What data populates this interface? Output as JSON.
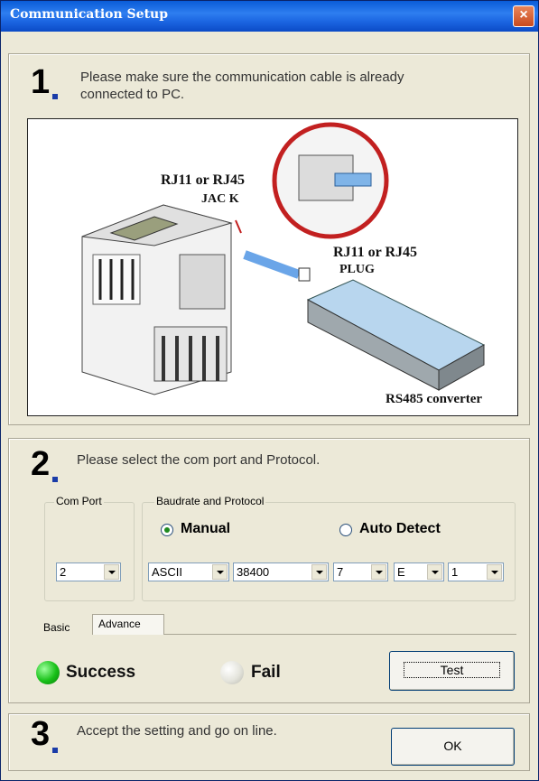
{
  "window": {
    "title": "Communication Setup",
    "close_symbol": "×"
  },
  "step1": {
    "number": "1",
    "text_line1": "Please make sure the communication cable is already",
    "text_line2": "connected to PC.",
    "image": {
      "jack_label_line1": "RJ11 or RJ45",
      "jack_label_line2": "JAC K",
      "plug_label_line1": "RJ11 or RJ45",
      "plug_label_line2": "PLUG",
      "converter_label": "RS485 converter"
    }
  },
  "step2": {
    "number": "2",
    "text": "Please select the com port and Protocol.",
    "com_port": {
      "caption": "Com Port",
      "value": "2"
    },
    "baud": {
      "caption": "Baudrate and Protocol",
      "manual_label": "Manual",
      "auto_label": "Auto Detect",
      "selected": "Manual",
      "protocol": "ASCII",
      "baudrate": "38400",
      "data_bits": "7",
      "parity": "E",
      "stop_bits": "1"
    },
    "tabs": [
      "Basic",
      "Advance"
    ],
    "active_tab": "Basic",
    "status": {
      "success_label": "Success",
      "fail_label": "Fail",
      "current": "Success"
    },
    "test_button": "Test"
  },
  "step3": {
    "number": "3",
    "text": "Accept the setting and go on line.",
    "ok_button": "OK"
  },
  "colors": {
    "title_bar": "#0a5cd8",
    "success_led": "#18c018",
    "fail_led": "#d8d8d0",
    "step_blue": "#1a3ca8"
  }
}
